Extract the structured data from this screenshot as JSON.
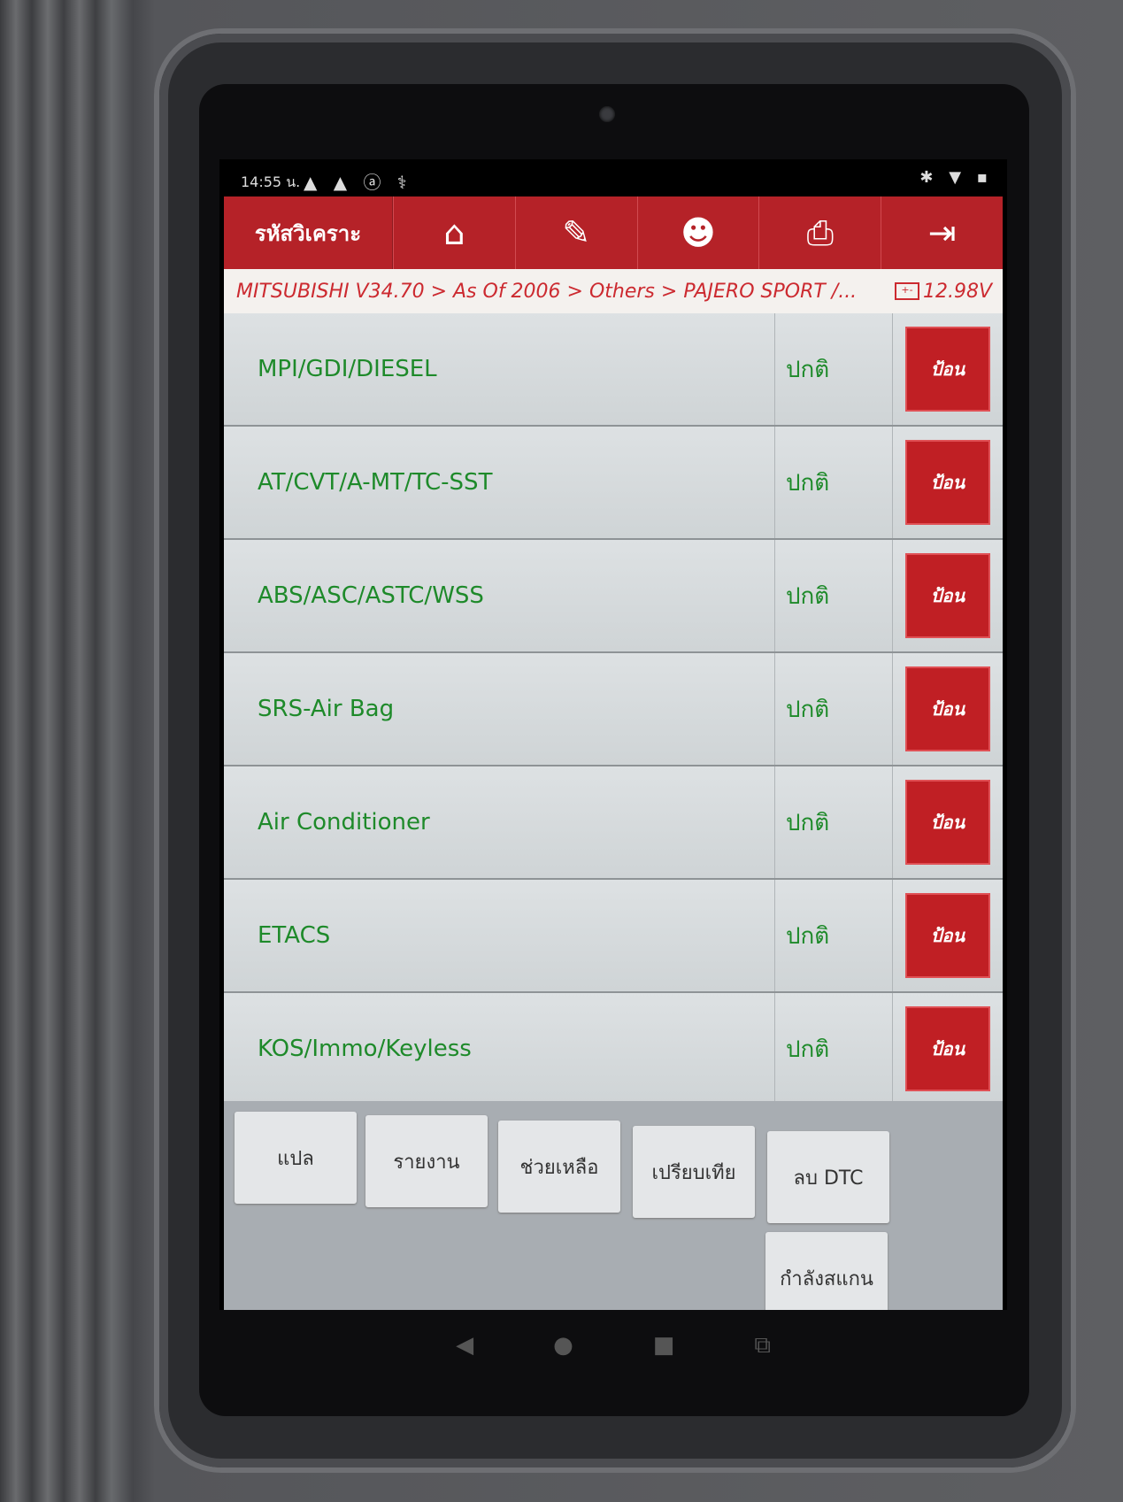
{
  "status_bar": {
    "time": "14:55 น.",
    "left_icons": "▲ ▲ ⓐ ⚕",
    "right_icons": "✱ ▼ ▪"
  },
  "toolbar": {
    "title": "รหัสวิเคราะ",
    "buttons": [
      {
        "name": "home",
        "glyph": "⌂"
      },
      {
        "name": "edit",
        "glyph": "✎"
      },
      {
        "name": "support",
        "glyph": "☻"
      },
      {
        "name": "print",
        "glyph": "⎙"
      },
      {
        "name": "exit",
        "glyph": "⇥"
      }
    ]
  },
  "breadcrumb": {
    "path": "MITSUBISHI V34.70 > As Of 2006 > Others > PAJERO SPORT /...",
    "voltage": "12.98V",
    "battery_glyph": "+-"
  },
  "systems": [
    {
      "name": "MPI/GDI/DIESEL",
      "status": "ปกติ",
      "action": "ป้อน"
    },
    {
      "name": "AT/CVT/A-MT/TC-SST",
      "status": "ปกติ",
      "action": "ป้อน"
    },
    {
      "name": "ABS/ASC/ASTC/WSS",
      "status": "ปกติ",
      "action": "ป้อน"
    },
    {
      "name": "SRS-Air Bag",
      "status": "ปกติ",
      "action": "ป้อน"
    },
    {
      "name": "Air Conditioner",
      "status": "ปกติ",
      "action": "ป้อน"
    },
    {
      "name": "ETACS",
      "status": "ปกติ",
      "action": "ป้อน"
    },
    {
      "name": "KOS/Immo/Keyless",
      "status": "ปกติ",
      "action": "ป้อน"
    }
  ],
  "footer_buttons": {
    "translate": "แปล",
    "report": "รายงาน",
    "help": "ช่วยเหลือ",
    "compare": "เปรียบเทีย",
    "clear_dtc": "ลบ DTC",
    "scanning": "กำลังสแกน"
  },
  "nav": {
    "back": "◀",
    "home": "●",
    "recent": "■",
    "screenshot": "⧉"
  }
}
